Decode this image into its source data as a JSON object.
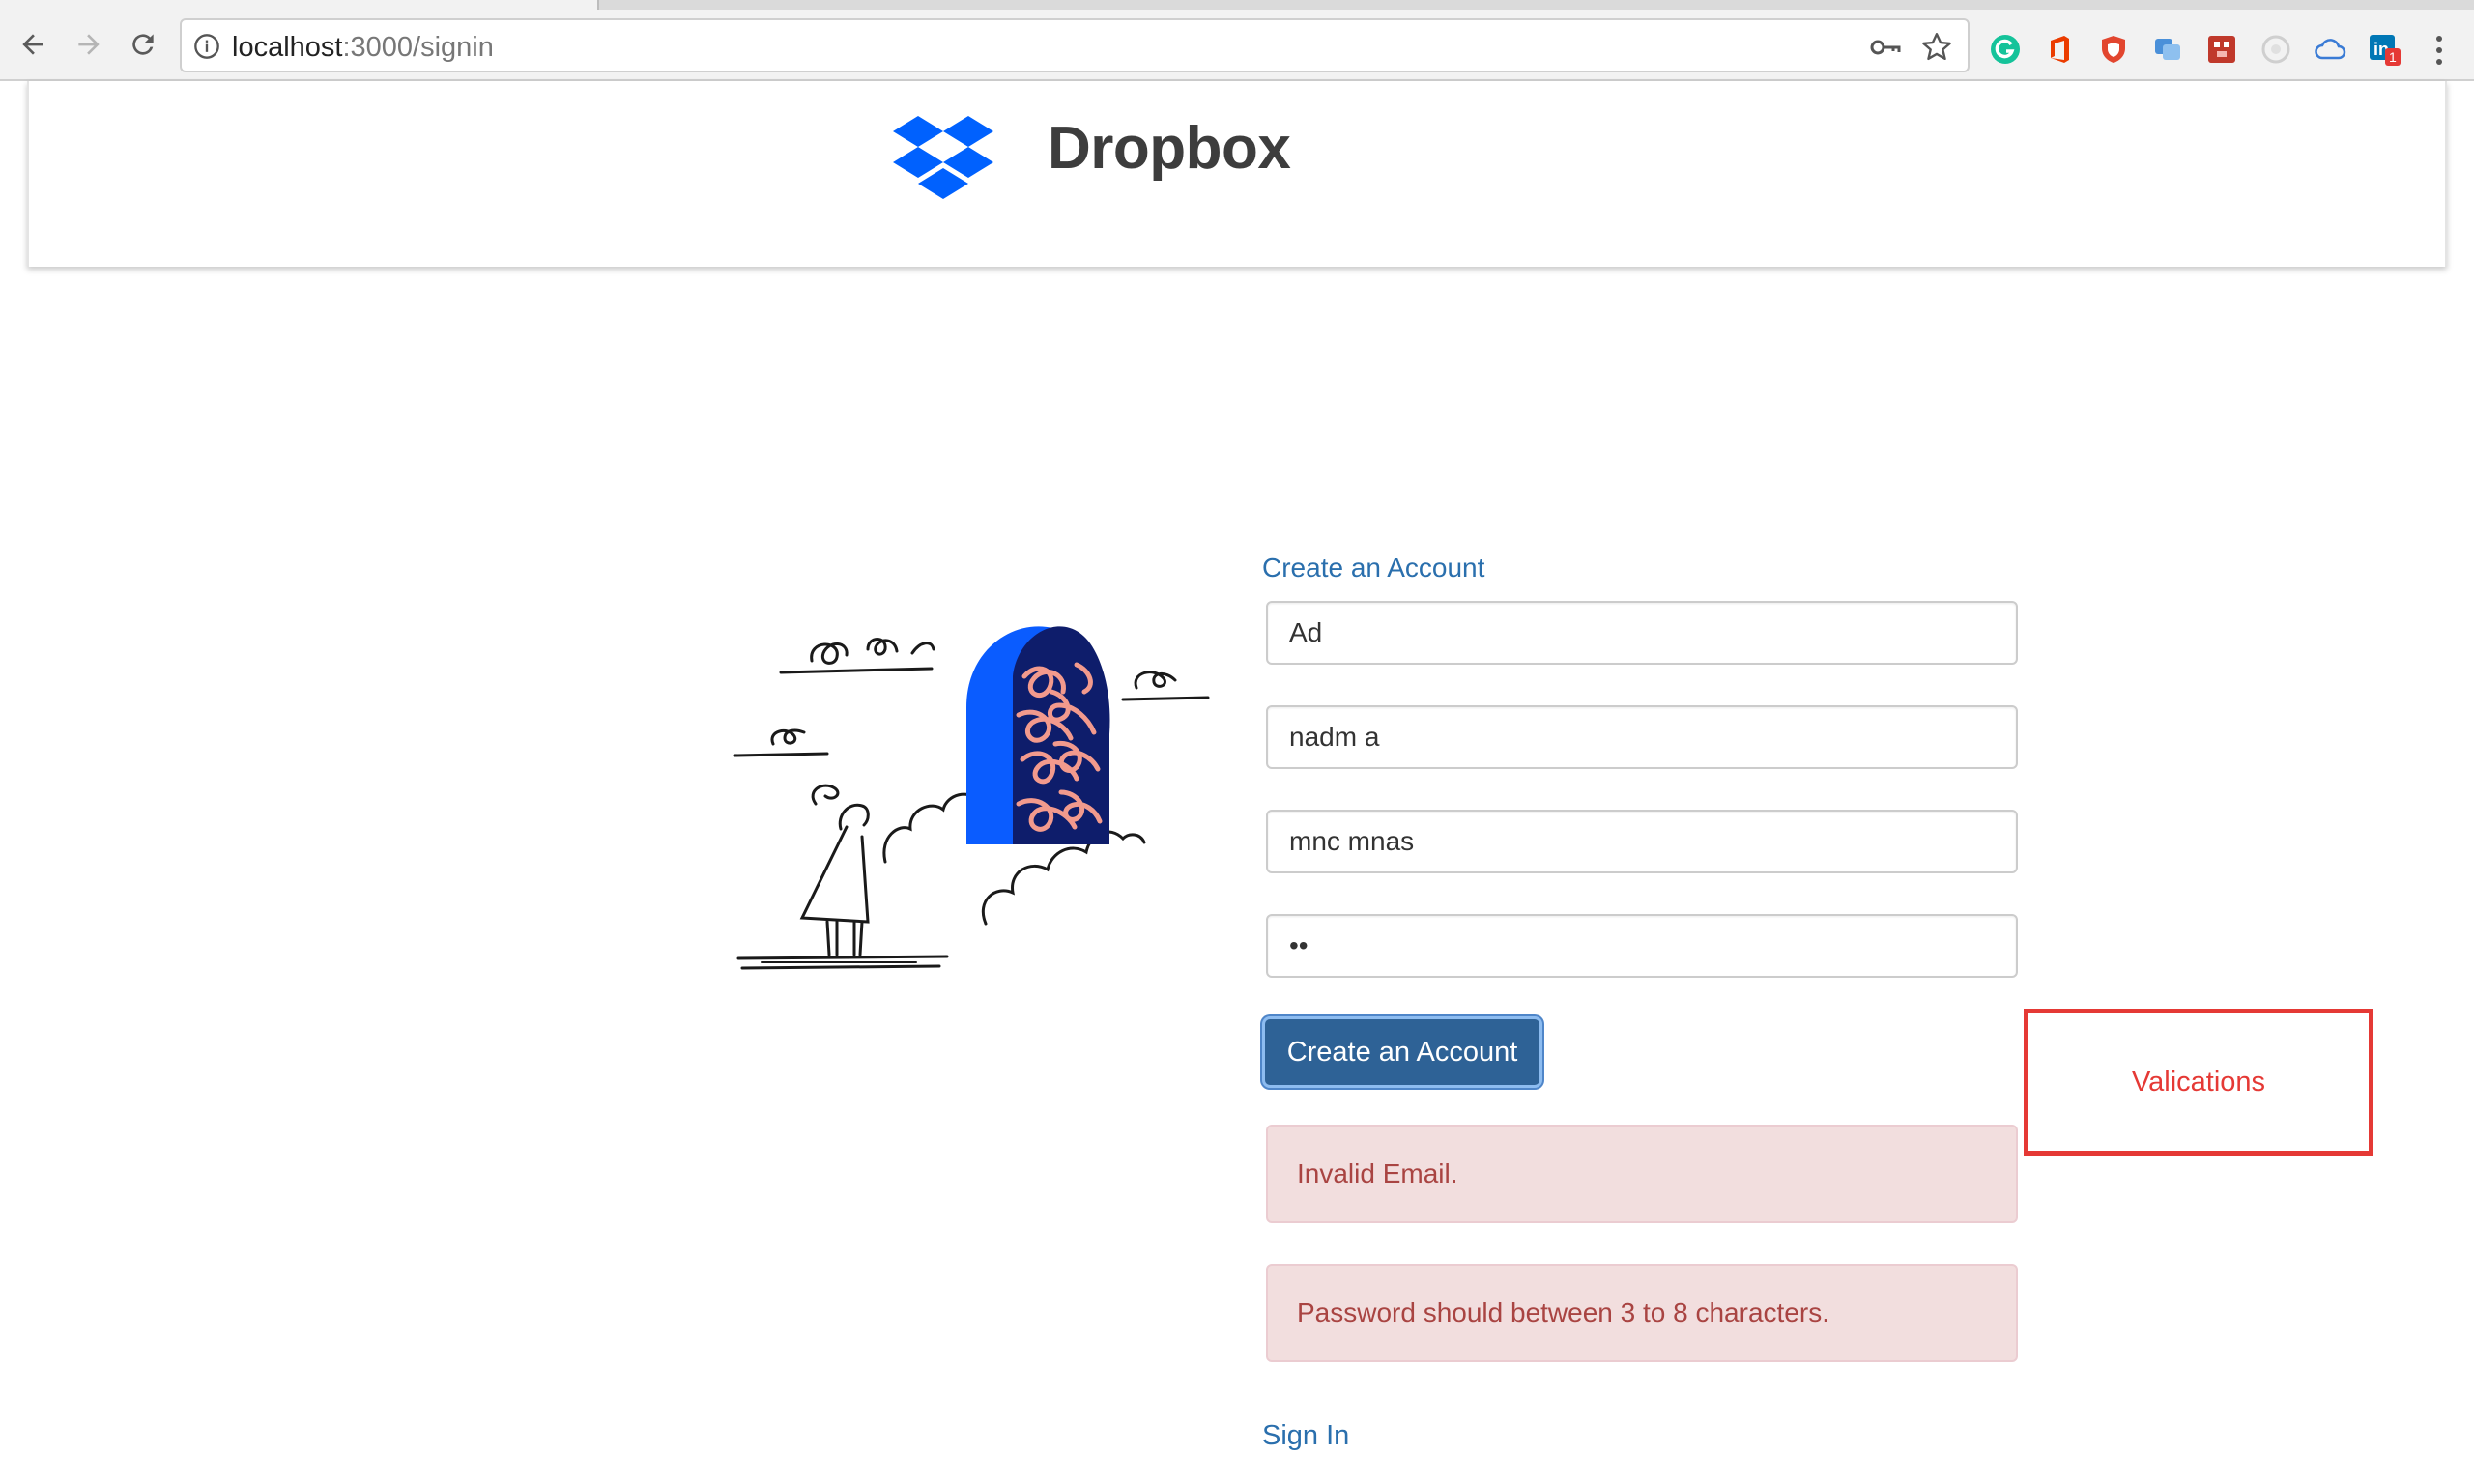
{
  "browser": {
    "url_host": "localhost",
    "url_path": ":3000/signin",
    "extension_badge": "1"
  },
  "header": {
    "brand": "Dropbox",
    "brand_color": "#0061fe"
  },
  "form": {
    "title": "Create an Account",
    "fields": [
      {
        "name": "first-name",
        "value": "Ad"
      },
      {
        "name": "last-name",
        "value": "nadm a"
      },
      {
        "name": "email",
        "value": "mnc mnas"
      },
      {
        "name": "password",
        "value": "••"
      }
    ],
    "submit_label": "Create an Account",
    "errors": [
      "Invalid Email.",
      "Password should between 3 to 8 characters."
    ],
    "signin_label": "Sign In"
  },
  "annotation": {
    "label": "Valications",
    "color": "#e53935"
  },
  "colors": {
    "link": "#2a6fad",
    "button": "#2e6296",
    "alert_bg": "#f2dede",
    "alert_text": "#a94442"
  }
}
